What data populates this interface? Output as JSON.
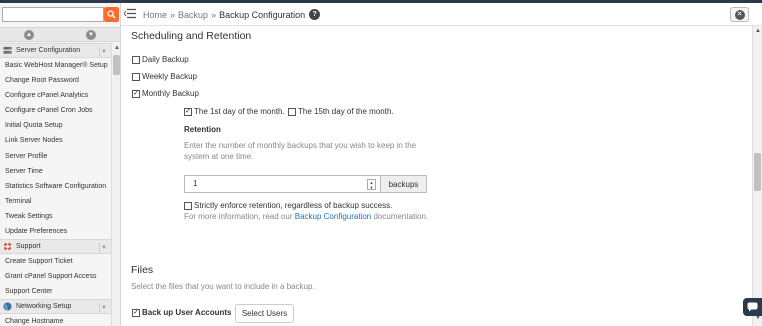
{
  "search": {
    "value": "",
    "placeholder": ""
  },
  "sidebar": {
    "groups": [
      {
        "label": "Server Configuration",
        "icon": "server-config-icon",
        "items": [
          "Basic WebHost Manager® Setup",
          "Change Root Password",
          "Configure cPanel Analytics",
          "Configure cPanel Cron Jobs",
          "Initial Quota Setup",
          "Link Server Nodes",
          "Server Profile",
          "Server Time",
          "Statistics Software Configuration",
          "Terminal",
          "Tweak Settings",
          "Update Preferences"
        ]
      },
      {
        "label": "Support",
        "icon": "lifebuoy-icon",
        "items": [
          "Create Support Ticket",
          "Grant cPanel Support Access",
          "Support Center"
        ]
      },
      {
        "label": "Networking Setup",
        "icon": "globe-icon",
        "items": [
          "Change Hostname"
        ]
      }
    ]
  },
  "header": {
    "breadcrumb": [
      "Home",
      "Backup",
      "Backup Configuration"
    ],
    "separator": "»"
  },
  "main": {
    "scheduling_title": "Scheduling and Retention",
    "daily_label": "Daily Backup",
    "daily_checked": false,
    "weekly_label": "Weekly Backup",
    "weekly_checked": false,
    "monthly_label": "Monthly Backup",
    "monthly_checked": true,
    "day1_label": "The 1st day of the month.",
    "day1_checked": true,
    "day15_label": "The 15th day of the month.",
    "day15_checked": false,
    "retention_title": "Retention",
    "retention_help": "Enter the number of monthly backups that you wish to keep in the system at one time.",
    "retention_value": "1",
    "retention_unit": "backups",
    "strict_label": "Strictly enforce retention, regardless of backup success.",
    "strict_checked": false,
    "more_info_prefix": "For more information, read our",
    "more_info_link": "Backup Configuration",
    "more_info_suffix": "documentation.",
    "files_title": "Files",
    "files_help": "Select the files that you want to include in a backup.",
    "backup_users_label": "Back up User Accounts",
    "backup_users_checked": true,
    "select_users_label": "Select Users"
  },
  "colors": {
    "accent": "#ff6c2c",
    "link": "#1a73c8",
    "topbar": "#293a4a"
  }
}
